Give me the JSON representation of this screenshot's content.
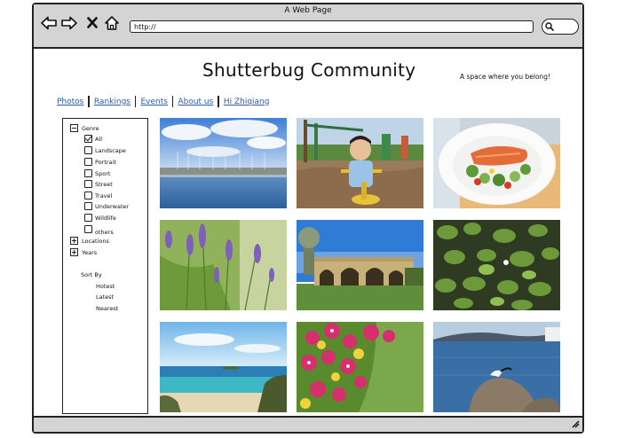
{
  "window": {
    "title": "A Web Page"
  },
  "browser": {
    "url": "http://"
  },
  "header": {
    "site_title": "Shutterbug Community",
    "tagline": "A space where you belong!"
  },
  "nav": {
    "items": [
      "Photos",
      "Rankings",
      "Events",
      "About us",
      "Hi Zhiqiang"
    ]
  },
  "sidebar": {
    "genre_label": "Genre",
    "genres": [
      {
        "label": "All",
        "checked": true
      },
      {
        "label": "Landscape",
        "checked": false
      },
      {
        "label": "Portrait",
        "checked": false
      },
      {
        "label": "Sport",
        "checked": false
      },
      {
        "label": "Street",
        "checked": false
      },
      {
        "label": "Travel",
        "checked": false
      },
      {
        "label": "Underwater",
        "checked": false
      },
      {
        "label": "Wildlife",
        "checked": false
      },
      {
        "label": "others",
        "checked": false
      }
    ],
    "locations_label": "Locations",
    "years_label": "Years",
    "sort_label": "Sort By",
    "sort_options": [
      "Hotest",
      "Latest",
      "Nearest"
    ]
  },
  "photos": [
    {
      "subject": "marina-harbor"
    },
    {
      "subject": "child-playground"
    },
    {
      "subject": "salmon-salad-plate"
    },
    {
      "subject": "purple-lavender-flowers"
    },
    {
      "subject": "stone-arch-bridge"
    },
    {
      "subject": "lily-pad-pond"
    },
    {
      "subject": "tropical-beach"
    },
    {
      "subject": "pink-yellow-flowers"
    },
    {
      "subject": "seabird-on-rock"
    }
  ]
}
